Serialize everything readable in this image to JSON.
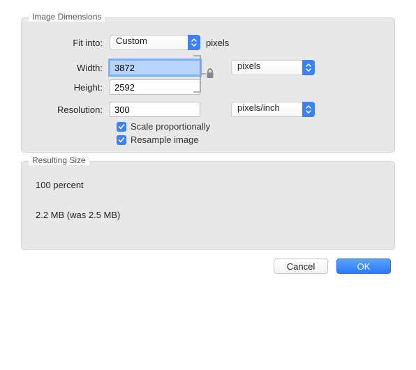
{
  "dimensions": {
    "group_label": "Image Dimensions",
    "fit_into_label": "Fit into:",
    "fit_into_value": "Custom",
    "fit_into_unit": "pixels",
    "width_label": "Width:",
    "width_value": "3872",
    "height_label": "Height:",
    "height_value": "2592",
    "wh_unit": "pixels",
    "resolution_label": "Resolution:",
    "resolution_value": "300",
    "resolution_unit": "pixels/inch",
    "scale_label": "Scale proportionally",
    "scale_checked": true,
    "resample_label": "Resample image",
    "resample_checked": true
  },
  "result": {
    "group_label": "Resulting Size",
    "percent_line": "100 percent",
    "size_line": "2.2 MB (was 2.5 MB)"
  },
  "buttons": {
    "cancel": "Cancel",
    "ok": "OK"
  }
}
